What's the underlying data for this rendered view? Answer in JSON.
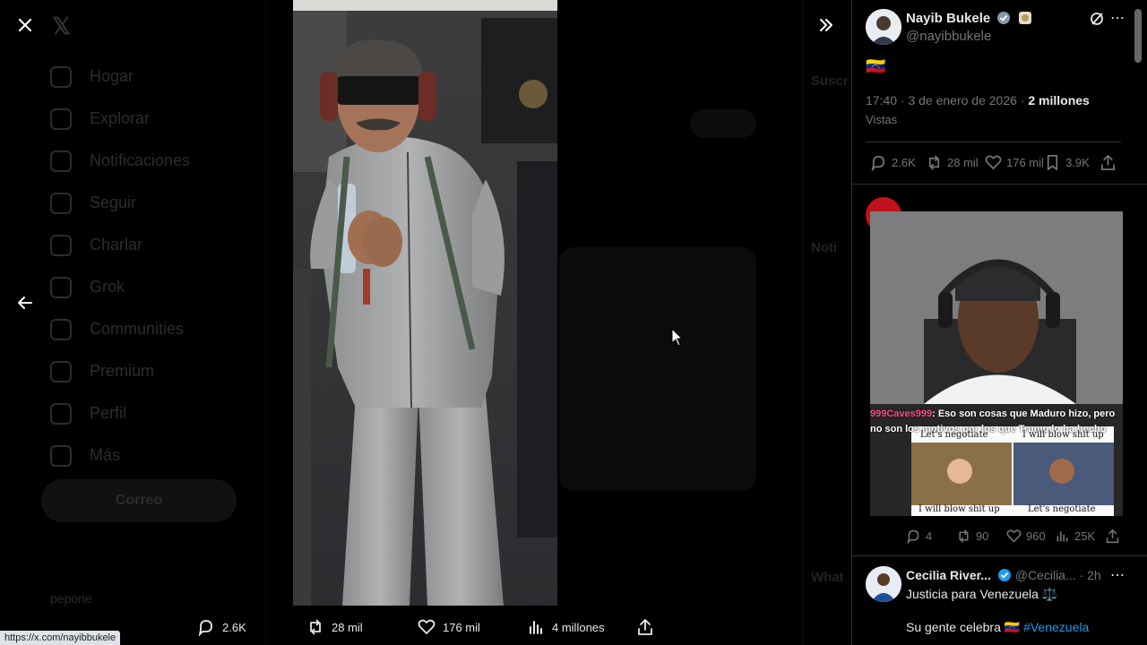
{
  "background": {
    "nav_items": [
      "Hogar",
      "Explorar",
      "Notificaciones",
      "Seguir",
      "Charlar",
      "Grok",
      "Communities",
      "Premium",
      "Perfil",
      "Más"
    ],
    "post_button": "Correo",
    "user_name": "pepone",
    "right_texts": [
      "Suscr",
      "Noti",
      "What"
    ]
  },
  "viewer": {
    "close_icon": "close-icon",
    "back_icon": "arrow-left-icon",
    "expand_icon": "double-chevron-right-icon"
  },
  "actions": {
    "replies": "2.6K",
    "reposts": "28 mil",
    "likes": "176 mil",
    "views": "4 millones"
  },
  "status_url": "https://x.com/nayibbukele",
  "tweet": {
    "author_name": "Nayib Bukele",
    "author_handle": "@nayibbukele",
    "body_emoji": "🇻🇪",
    "time": "17:40 · 3 de enero de 2026",
    "views_count": "2 millones",
    "views_label": "Vistas",
    "replies": "2.6K",
    "reposts": "28 mil",
    "likes": "176 mil",
    "bookmarks": "3.9K"
  },
  "overlay": {
    "chat_user": "999Caves999",
    "chat_text": ": Eso son cosas que Maduro hizo, pero no son los motivos por los que Trump lo ha hecho",
    "meme_top_left": "Let's negotiate",
    "meme_top_right": "I will blow shit up",
    "meme_bottom_left": "I will blow shit up",
    "meme_bottom_right": "Let's negotiate"
  },
  "reply1": {
    "replies": "4",
    "reposts": "90",
    "likes": "960",
    "views": "25K"
  },
  "reply2": {
    "name": "Cecilia River...",
    "handle": "@Cecilia...",
    "time": "· 2h",
    "line1": "Justicia para Venezuela ⚖️",
    "line2_prefix": "Su gente celebra 🇻🇪 ",
    "hashtag": "#Venezuela"
  },
  "colors": {
    "accent": "#1d9bf0",
    "chat_name": "#ff4d8a"
  }
}
